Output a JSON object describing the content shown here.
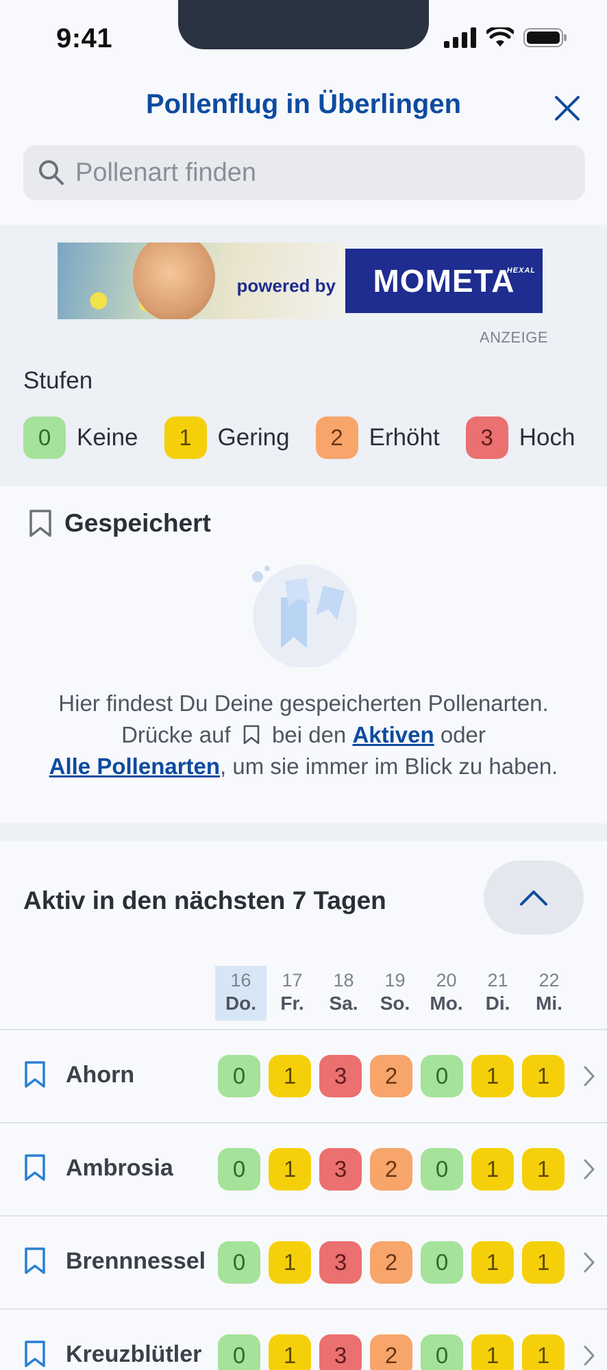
{
  "status_bar": {
    "time": "9:41"
  },
  "header": {
    "title": "Pollenflug in Überlingen",
    "search_placeholder": "Pollenart finden"
  },
  "ad": {
    "powered_by": "powered by",
    "brand": "MOMETA",
    "brand_sub": "HEXAL",
    "label": "ANZEIGE"
  },
  "levels": {
    "title": "Stufen",
    "items": [
      {
        "value": "0",
        "label": "Keine"
      },
      {
        "value": "1",
        "label": "Gering"
      },
      {
        "value": "2",
        "label": "Erhöht"
      },
      {
        "value": "3",
        "label": "Hoch"
      }
    ]
  },
  "saved": {
    "title": "Gespeichert",
    "text_line1": "Hier findest Du Deine gespeicherten Pollenarten.",
    "text_line2_pre": "Drücke auf",
    "text_line2_mid": "bei den",
    "link_active": "Aktiven",
    "text_line2_post": "oder",
    "link_all": "Alle Pollenarten",
    "text_line3_post": ", um sie immer im Blick zu haben."
  },
  "active": {
    "title": "Aktiv in den nächsten 7 Tagen",
    "days": [
      {
        "num": "16",
        "name": "Do."
      },
      {
        "num": "17",
        "name": "Fr."
      },
      {
        "num": "18",
        "name": "Sa."
      },
      {
        "num": "19",
        "name": "So."
      },
      {
        "num": "20",
        "name": "Mo."
      },
      {
        "num": "21",
        "name": "Di."
      },
      {
        "num": "22",
        "name": "Mi."
      }
    ],
    "rows": [
      {
        "name": "Ahorn",
        "levels": [
          0,
          1,
          3,
          2,
          0,
          1,
          1
        ]
      },
      {
        "name": "Ambrosia",
        "levels": [
          0,
          1,
          3,
          2,
          0,
          1,
          1
        ]
      },
      {
        "name": "Brennnessel",
        "levels": [
          0,
          1,
          3,
          2,
          0,
          1,
          1
        ]
      },
      {
        "name": "Kreuzblütler",
        "levels": [
          0,
          1,
          3,
          2,
          0,
          1,
          1
        ]
      }
    ]
  },
  "colors": {
    "accent": "#0d4ba0",
    "level_0": "#a5e29a",
    "level_1": "#f5d00a",
    "level_2": "#f7a56a",
    "level_3": "#eb7070"
  }
}
